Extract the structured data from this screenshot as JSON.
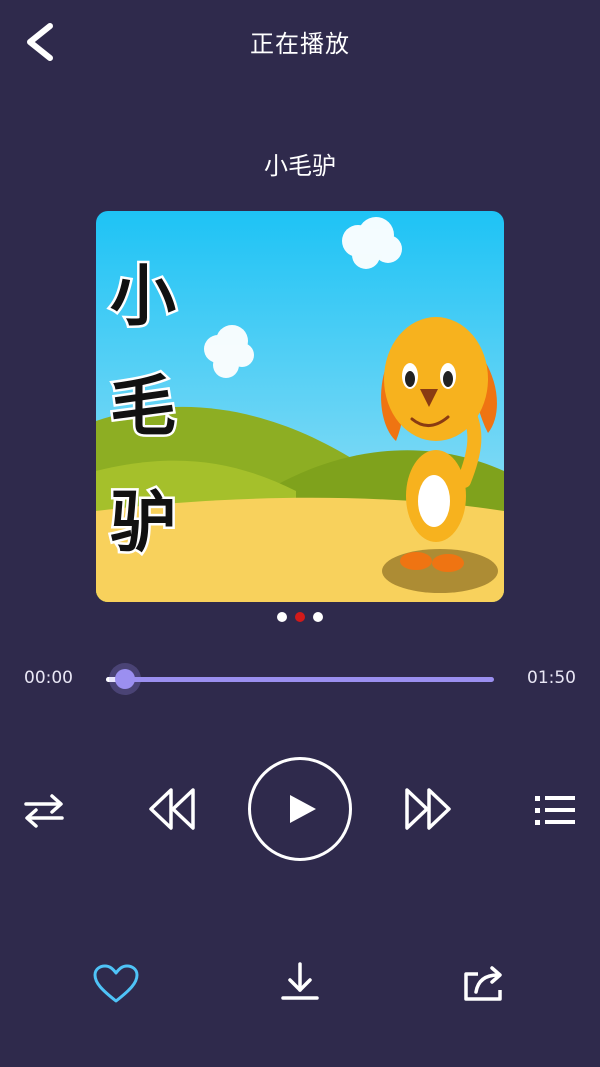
{
  "header": {
    "title": "正在播放",
    "back_icon": "back-arrow-icon"
  },
  "song": {
    "title": "小毛驴"
  },
  "cover": {
    "art_text": "小毛驴",
    "colors": {
      "sky_top": "#1ec3f5",
      "sky_bottom": "#8ad9f4",
      "hill": "#8dae23",
      "ground": "#f8d15c",
      "dog": "#f7b21e",
      "ear": "#ef7412"
    }
  },
  "pager": {
    "count": 3,
    "active_index": 1,
    "active_color": "#d21a1a"
  },
  "playback": {
    "current_time": "00:00",
    "total_time": "01:50",
    "progress": 0.05
  },
  "controls": {
    "repeat_icon": "repeat-icon",
    "rewind_icon": "rewind-icon",
    "play_icon": "play-icon",
    "forward_icon": "fast-forward-icon",
    "playlist_icon": "playlist-icon"
  },
  "actions": {
    "favorite_icon": "heart-icon",
    "download_icon": "download-icon",
    "share_icon": "share-icon",
    "favorite_color": "#4fc3f7"
  },
  "theme": {
    "background": "#2f2a4c",
    "accent": "#9b8ff0"
  }
}
